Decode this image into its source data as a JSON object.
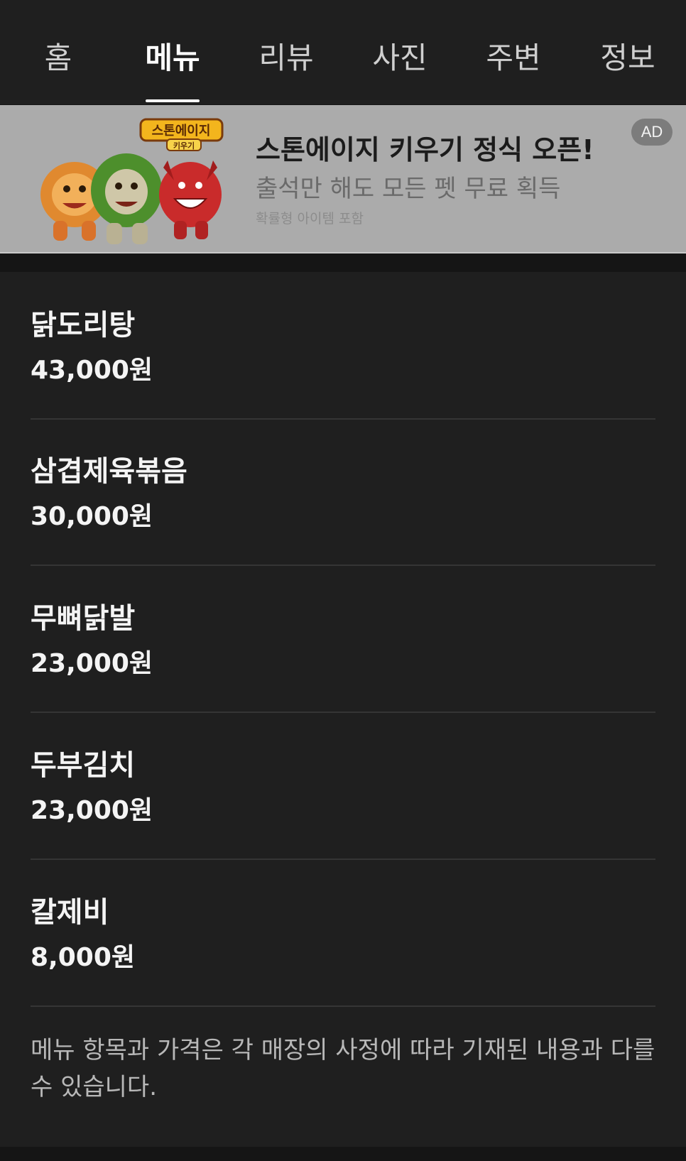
{
  "tabs": [
    {
      "label": "홈",
      "active": false
    },
    {
      "label": "메뉴",
      "active": true
    },
    {
      "label": "리뷰",
      "active": false
    },
    {
      "label": "사진",
      "active": false
    },
    {
      "label": "주변",
      "active": false
    },
    {
      "label": "정보",
      "active": false
    }
  ],
  "ad": {
    "title": "스톤에이지 키우기 정식 오픈!",
    "subtitle": "출석만 해도 모든 펫 무료 획득",
    "note": "확률형 아이템 포함",
    "badge": "AD",
    "logo_text": "스톤에이지",
    "logo_subtext": "키우기"
  },
  "menu_items": [
    {
      "name": "닭도리탕",
      "price": "43,000원"
    },
    {
      "name": "삼겹제육볶음",
      "price": "30,000원"
    },
    {
      "name": "무뼈닭발",
      "price": "23,000원"
    },
    {
      "name": "두부김치",
      "price": "23,000원"
    },
    {
      "name": "칼제비",
      "price": "8,000원"
    }
  ],
  "disclaimer": "메뉴 항목과 가격은 각 매장의 사정에 따라 기재된 내용과 다를 수 있습니다.",
  "colors": {
    "background": "#1f1f1f",
    "tab_active": "#ffffff",
    "tab_inactive": "#cfcfcf",
    "ad_background": "#ababab",
    "divider": "#353535"
  }
}
